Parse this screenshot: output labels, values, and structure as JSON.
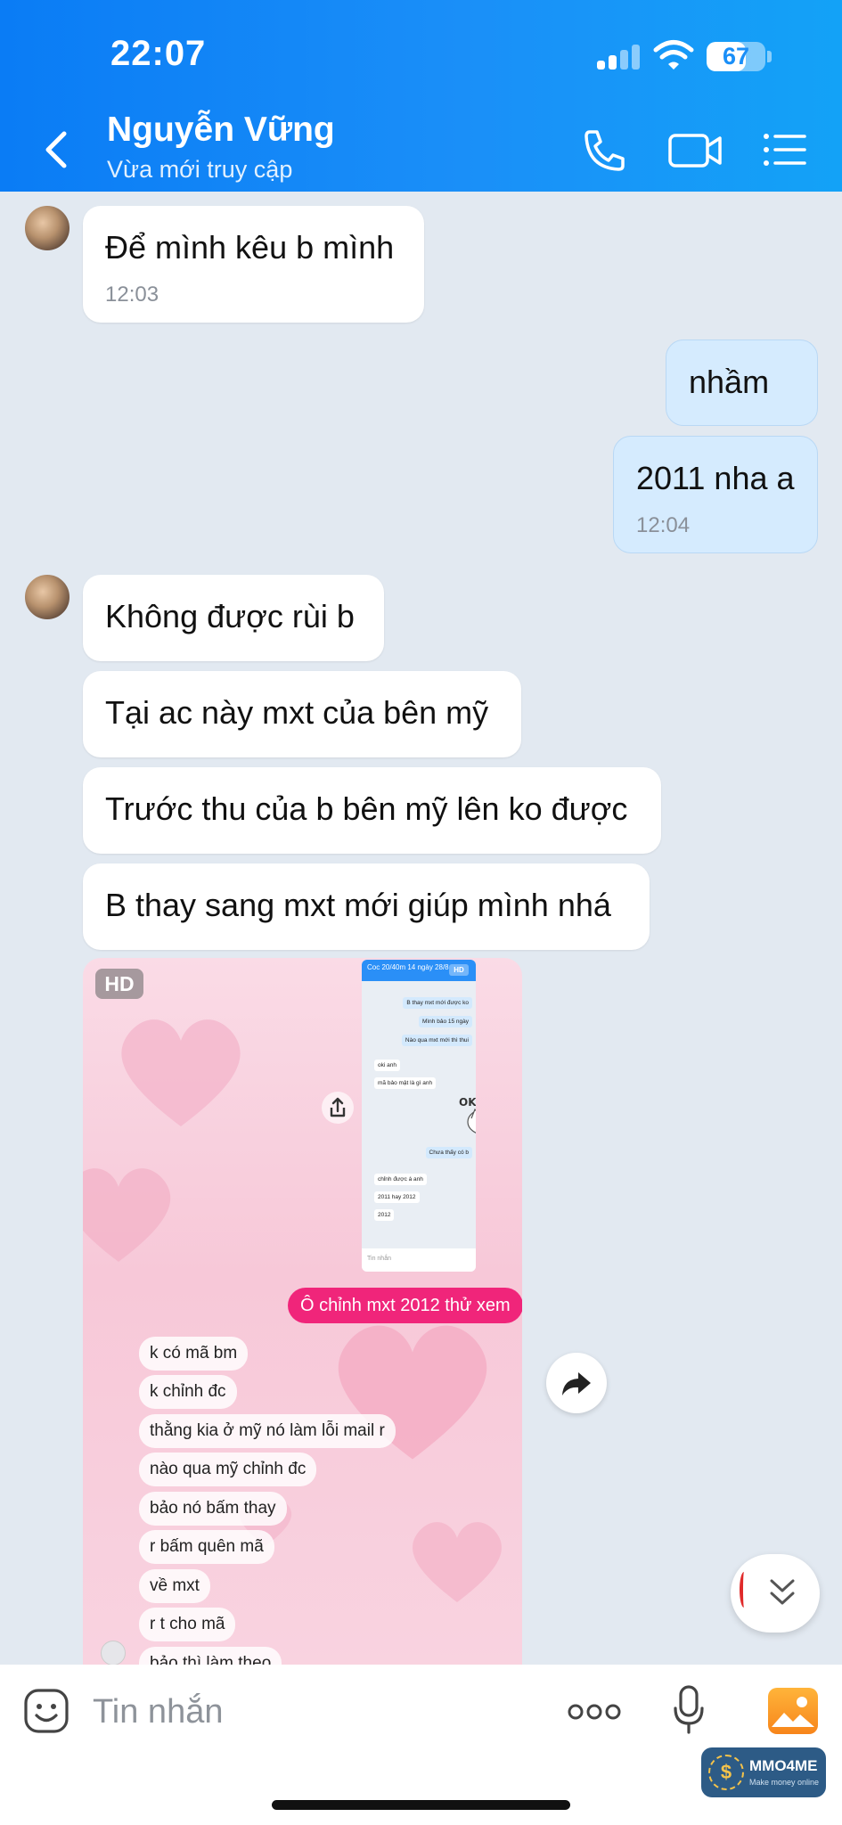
{
  "status_bar": {
    "time": "22:07",
    "battery": "67",
    "battery_level": 0.67
  },
  "header": {
    "contact_name": "Nguyễn Vững",
    "contact_status": "Vừa mới truy cập",
    "icons": [
      "back-chevron-icon",
      "phone-icon",
      "video-camera-icon",
      "menu-list-icon"
    ]
  },
  "messages": [
    {
      "dir": "in",
      "text": "Để mình kêu b mình",
      "time": "12:03"
    },
    {
      "dir": "out",
      "text": "nhầm"
    },
    {
      "dir": "out",
      "text": "2011 nha a",
      "time": "12:04"
    },
    {
      "dir": "in",
      "text": "Không được rùi b"
    },
    {
      "dir": "in",
      "text": "Tại ac này mxt của bên mỹ"
    },
    {
      "dir": "in",
      "text": "Trước thu của b bên mỹ lên ko được"
    },
    {
      "dir": "in",
      "text": "B thay sang mxt mới giúp mình nhá"
    }
  ],
  "image_message": {
    "badge": "HD",
    "nested_screenshot": {
      "header": "Coc 20/40m 14 ngày 28/8",
      "badge": "HD",
      "bubbles": [
        {
          "dir": "out",
          "text": "B thay mxt mới được ko"
        },
        {
          "dir": "out",
          "text": "Mình bảo 15 ngày"
        },
        {
          "dir": "out",
          "text": "Nào qua mxt mới thì thui"
        },
        {
          "dir": "in",
          "text": "oki anh"
        },
        {
          "dir": "in",
          "text": "mã bảo mật là gì anh"
        },
        {
          "dir": "out",
          "text": "Chưa thấy có b"
        },
        {
          "dir": "in",
          "text": "chỉnh được á anh"
        },
        {
          "dir": "in",
          "text": "2011 hay 2012"
        },
        {
          "dir": "in",
          "text": "2012"
        }
      ],
      "sticker_text": "OK",
      "input_placeholder": "Tin nhắn"
    },
    "pink_message": "Ô chỉnh mxt 2012 thử xem",
    "chips": [
      "k có mã bm",
      "k chỉnh đc",
      "thằng kia ở mỹ nó làm lỗi mail r",
      "nào qua mỹ chỉnh đc",
      "bảo nó bấm thay",
      "r bấm quên mã",
      "về mxt",
      "r t cho mã",
      "bảo thì làm theo"
    ]
  },
  "input_bar": {
    "placeholder": "Tin nhắn",
    "icons": [
      "emoji-icon",
      "more-dots-icon",
      "microphone-icon",
      "photo-gallery-icon"
    ]
  },
  "watermark": {
    "title": "MMO4ME",
    "subtitle": "Make money online"
  },
  "colors": {
    "header_gradient_start": "#0a7cf5",
    "header_gradient_end": "#13a2f7",
    "chat_background": "#e2e9f1",
    "outgoing_bubble": "#d5ebfe",
    "incoming_bubble": "#ffffff",
    "pink_message": "#f0257a",
    "photo_button": "#f7851b"
  }
}
